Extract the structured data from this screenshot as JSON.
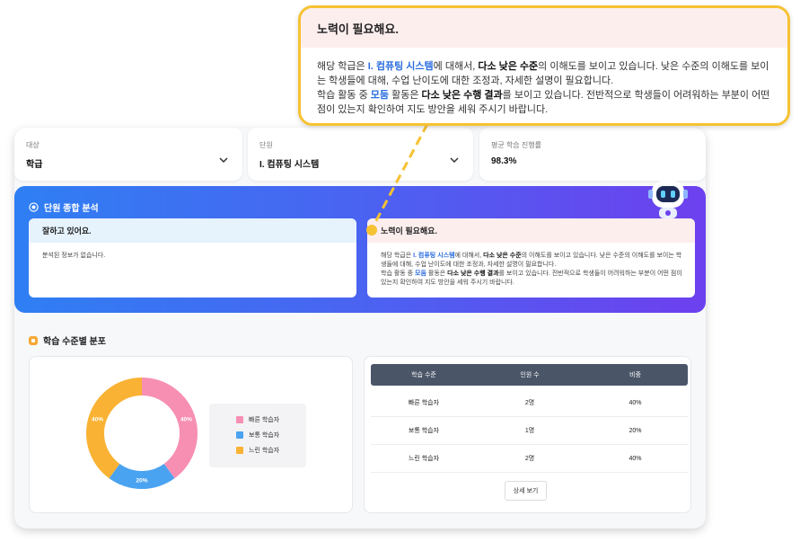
{
  "filters": {
    "target": {
      "label": "대상",
      "value": "학급"
    },
    "unit": {
      "label": "단원",
      "value": "I. 컴퓨팅 시스템"
    },
    "progress": {
      "label": "평균 학습 진행률",
      "value": "98.3%"
    }
  },
  "analysis": {
    "title": "단원 종합 분석",
    "good": {
      "title": "잘하고 있어요.",
      "body": "분석된 정보가 없습니다."
    },
    "effort": {
      "title": "노력이 필요해요.",
      "p1_a": "해당 학급은 ",
      "p1_unit": "I. 컴퓨팅 시스템",
      "p1_b": "에 대해서, ",
      "p1_c": "다소 낮은 수준",
      "p1_d": "의 이해도를 보이고 있습니다. 낮은 수준의 이해도를 보이는 학생들에 대해, 수업 난이도에 대한 조정과, 자세한 설명이 필요합니다.",
      "p2_a": "학습 활동 중 ",
      "p2_mod": "모둠",
      "p2_b": " 활동은 ",
      "p2_c": "다소 낮은 수행 결과",
      "p2_d": "를 보이고 있습니다. 전반적으로 학생들이 어려워하는 부분이 어떤 점이 있는지 확인하여 지도 방안을 세워 주시기 바랍니다."
    }
  },
  "distribution": {
    "title": "학습 수준별 분포",
    "legend": [
      "빠른 학습자",
      "보통 학습자",
      "느린 학습자"
    ],
    "table_headers": [
      "학습 수준",
      "인원 수",
      "비중"
    ],
    "rows": [
      [
        "빠른 학습자",
        "2명",
        "40%"
      ],
      [
        "보통 학습자",
        "1명",
        "20%"
      ],
      [
        "느린 학습자",
        "2명",
        "40%"
      ]
    ],
    "more_button": "상세 보기"
  },
  "chart_data": {
    "type": "pie",
    "categories": [
      "빠른 학습자",
      "보통 학습자",
      "느린 학습자"
    ],
    "values": [
      40,
      20,
      40
    ],
    "labels": [
      "40%",
      "20%",
      "40%"
    ],
    "colors": [
      "#f78fb3",
      "#4aa3f0",
      "#f9b233"
    ]
  },
  "colors": {
    "accent_blue": "#2a6dde",
    "callout_border": "#f6c232",
    "effort_header": "#fdeeee",
    "good_header": "#e6f2fc"
  }
}
